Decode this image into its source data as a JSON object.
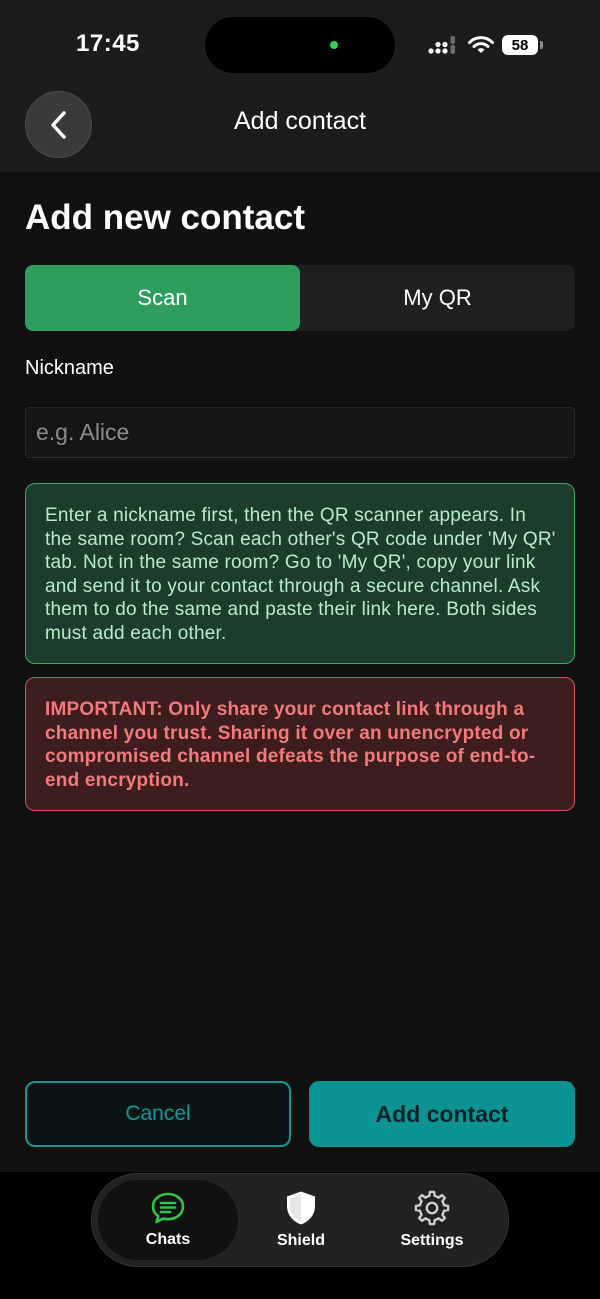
{
  "status_bar": {
    "time": "17:45",
    "battery": "58"
  },
  "header": {
    "title": "Add contact",
    "back_icon": "chevron-left-icon"
  },
  "page": {
    "heading": "Add new contact"
  },
  "tabs": {
    "scan": "Scan",
    "my_qr": "My QR",
    "selected": "Scan"
  },
  "form": {
    "nickname_label": "Nickname",
    "nickname_value": "",
    "nickname_placeholder": "e.g. Alice"
  },
  "info_text": "Enter a nickname first, then the QR scanner appears. In the same room? Scan each other's QR code under 'My QR' tab. Not in the same room? Go to 'My QR', copy your link and send it to your contact through a secure channel. Ask them to do the same and paste their link here. Both sides must add each other.",
  "warning_text": "IMPORTANT: Only share your contact link through a channel you trust. Sharing it over an unencrypted or compromised channel defeats the purpose of end-to-end encryption.",
  "actions": {
    "cancel": "Cancel",
    "add": "Add contact"
  },
  "tab_bar": {
    "items": [
      {
        "label": "Chats",
        "icon": "chat-bubble-icon",
        "active": true
      },
      {
        "label": "Shield",
        "icon": "shield-icon",
        "active": false
      },
      {
        "label": "Settings",
        "icon": "gear-icon",
        "active": false
      }
    ]
  },
  "colors": {
    "accent_green": "#2e9e5e",
    "teal": "#0d9394",
    "info_border": "#3da768",
    "warning_border": "#d9545a",
    "chat_icon_green": "#2fc44a"
  }
}
